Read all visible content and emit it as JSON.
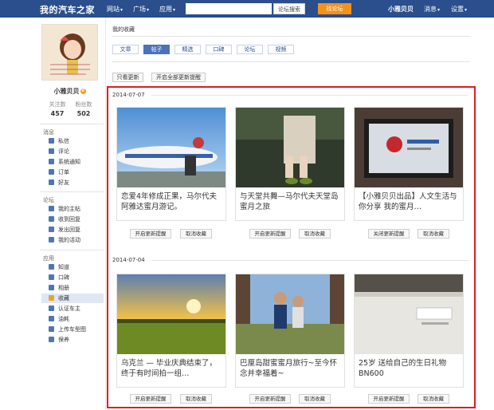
{
  "topbar": {
    "logo": "我的汽车之家",
    "nav": [
      {
        "label": "网站"
      },
      {
        "label": "广场"
      },
      {
        "label": "应用"
      }
    ],
    "search_placeholder": "",
    "search_button": "论坛搜索",
    "forum_button": "找论坛",
    "user_name": "小雅贝贝",
    "right_nav": [
      {
        "label": "消息"
      },
      {
        "label": "设置"
      }
    ]
  },
  "profile": {
    "name": "小雅贝贝",
    "badge": "V",
    "stats": [
      {
        "label": "关注数",
        "value": "457"
      },
      {
        "label": "粉丝数",
        "value": "502"
      }
    ]
  },
  "sidebar": {
    "sections": [
      {
        "title": "消息",
        "items": [
          {
            "label": "私信"
          },
          {
            "label": "评论"
          },
          {
            "label": "系统通知"
          },
          {
            "label": "订单"
          },
          {
            "label": "好友"
          }
        ]
      },
      {
        "title": "论坛",
        "items": [
          {
            "label": "我的主帖"
          },
          {
            "label": "收到回复"
          },
          {
            "label": "发出回复"
          },
          {
            "label": "我的活动"
          }
        ]
      },
      {
        "title": "应用",
        "items": [
          {
            "label": "知道"
          },
          {
            "label": "口碑"
          },
          {
            "label": "相册"
          },
          {
            "label": "收藏"
          },
          {
            "label": "认证车主"
          },
          {
            "label": "油耗"
          },
          {
            "label": "上传车型图"
          },
          {
            "label": "保养"
          }
        ]
      }
    ],
    "active_item": "收藏"
  },
  "main": {
    "breadcrumb": "我的收藏",
    "tabs": [
      {
        "label": "文章"
      },
      {
        "label": "帖子"
      },
      {
        "label": "精选"
      },
      {
        "label": "口碑"
      },
      {
        "label": "论坛"
      },
      {
        "label": "视频"
      }
    ],
    "active_tab": "帖子",
    "filters": [
      {
        "label": "只看更新"
      },
      {
        "label": "开启全部更新提醒"
      }
    ],
    "groups": [
      {
        "date": "2014-07-07",
        "cards": [
          {
            "title": "恋爱4年修成正果，马尔代夫阿雅达蜜月游记。",
            "btn_left": "开启更新提醒",
            "btn_right": "取消收藏"
          },
          {
            "title": "与天堂共舞—马尔代夫天堂岛蜜月之旅",
            "btn_left": "开启更新提醒",
            "btn_right": "取消收藏"
          },
          {
            "title": "【小雅贝贝出品】人文生活与你分享 我的蜜月…",
            "btn_left": "关闭更新提醒",
            "btn_right": "取消收藏"
          }
        ]
      },
      {
        "date": "2014-07-04",
        "cards": [
          {
            "title": "乌克兰 — 毕业庆典结束了，终于有时间拍一组…",
            "btn_left": "开启更新提醒",
            "btn_right": "取消收藏"
          },
          {
            "title": "巴厘岛甜蜜蜜月旅行~至今怀念并幸福着~",
            "btn_left": "开启更新提醒",
            "btn_right": "取消收藏"
          },
          {
            "title": "25岁 送给自己的生日礼物BN600",
            "btn_left": "开启更新提醒",
            "btn_right": "取消收藏"
          }
        ]
      }
    ]
  },
  "colors": {
    "topbar": "#2b4e8c",
    "accent": "#4a73b8",
    "forum_button": "#f3921b",
    "highlight_box": "#e11b1b"
  }
}
